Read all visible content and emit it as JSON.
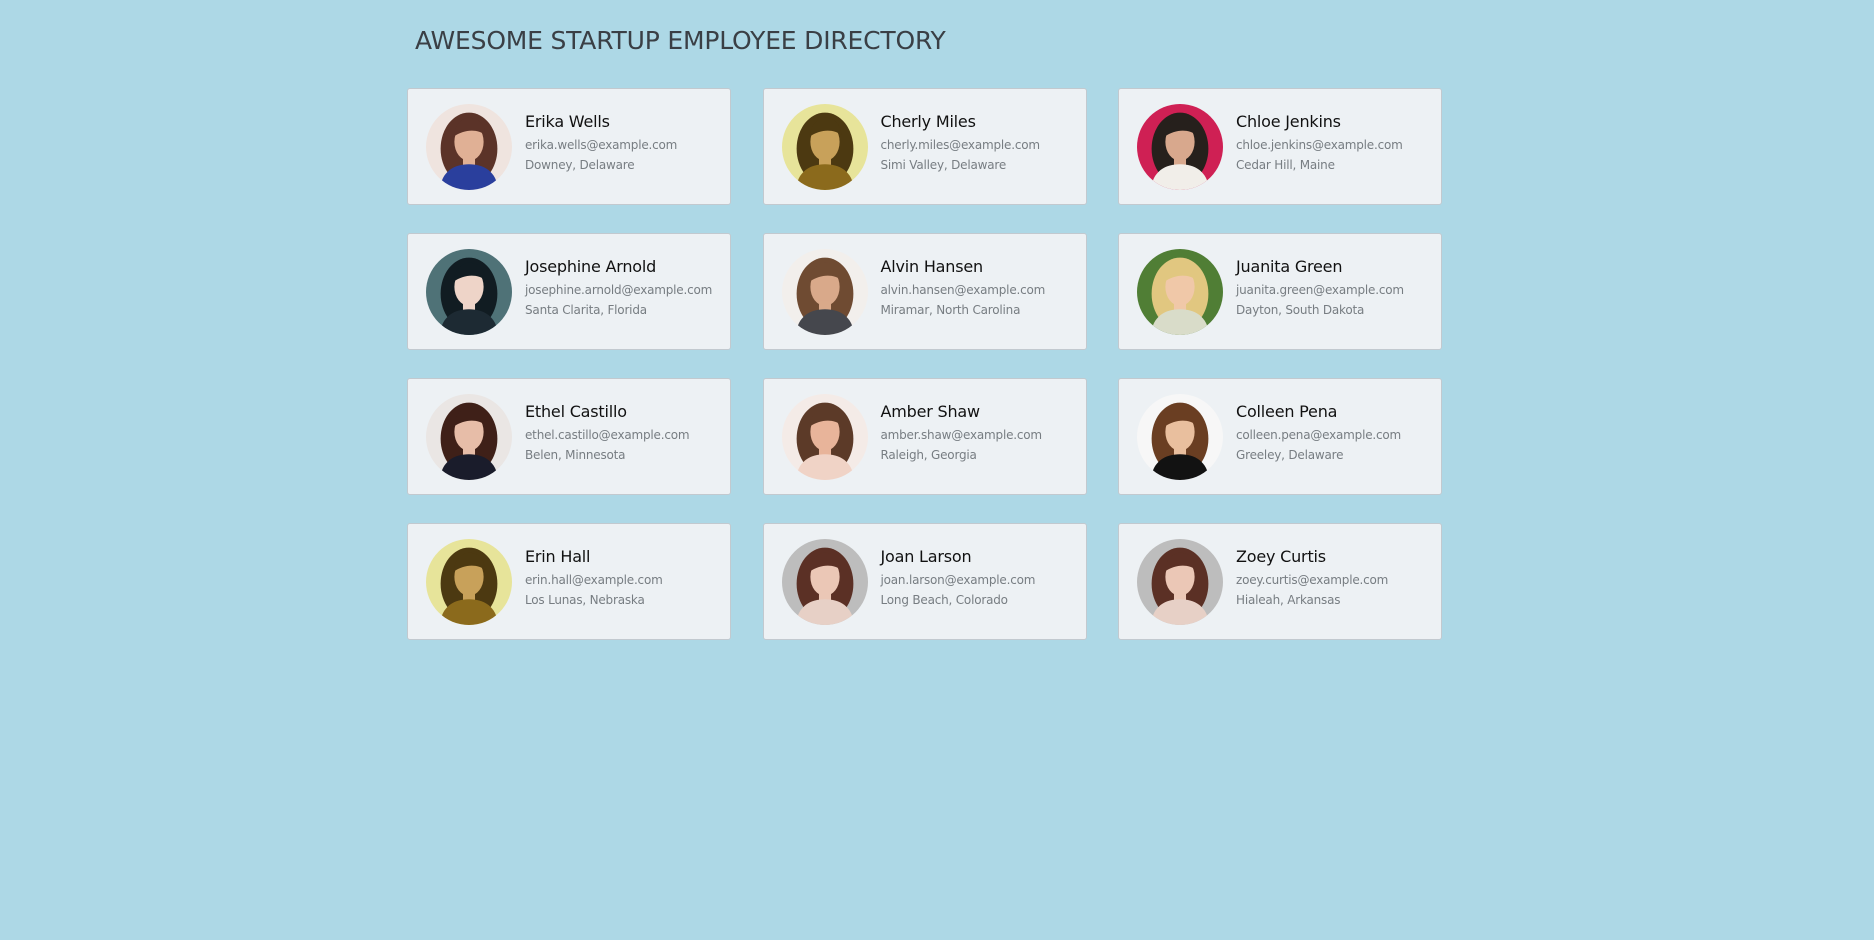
{
  "page": {
    "title": "AWESOME STARTUP EMPLOYEE DIRECTORY",
    "background": "#add8e6",
    "card_background": "#edf1f4",
    "card_border": "#c2c9cf"
  },
  "employees": [
    {
      "name": "Erika Wells",
      "email": "erika.wells@example.com",
      "location": "Downey, Delaware",
      "avatar": {
        "icon": "avatar-woman-brown-hair",
        "bg": "#efe4df",
        "hair": "#5b3328",
        "skin": "#e0b095",
        "shirt": "#2a3f9d"
      }
    },
    {
      "name": "Cherly Miles",
      "email": "cherly.miles@example.com",
      "location": "Simi Valley, Delaware",
      "avatar": {
        "icon": "avatar-woman-yellow-light",
        "bg": "#e7e49a",
        "hair": "#4c3911",
        "skin": "#c8a15a",
        "shirt": "#8b6a1c"
      }
    },
    {
      "name": "Chloe Jenkins",
      "email": "chloe.jenkins@example.com",
      "location": "Cedar Hill, Maine",
      "avatar": {
        "icon": "avatar-woman-curly-hair",
        "bg": "#cf2054",
        "hair": "#26201c",
        "skin": "#d8a88d",
        "shirt": "#f1eee9"
      }
    },
    {
      "name": "Josephine Arnold",
      "email": "josephine.arnold@example.com",
      "location": "Santa Clarita, Florida",
      "avatar": {
        "icon": "avatar-woman-dark-hair",
        "bg": "#4f7277",
        "hair": "#111c22",
        "skin": "#eed4c8",
        "shirt": "#1d2a33"
      }
    },
    {
      "name": "Alvin Hansen",
      "email": "alvin.hansen@example.com",
      "location": "Miramar, North Carolina",
      "avatar": {
        "icon": "avatar-man-smiling",
        "bg": "#f2efec",
        "hair": "#6f4b32",
        "skin": "#d9a98a",
        "shirt": "#45474d"
      }
    },
    {
      "name": "Juanita Green",
      "email": "juanita.green@example.com",
      "location": "Dayton, South Dakota",
      "avatar": {
        "icon": "avatar-woman-blonde",
        "bg": "#507e35",
        "hair": "#e1c780",
        "skin": "#f0c8a8",
        "shirt": "#d9dcc9"
      }
    },
    {
      "name": "Ethel Castillo",
      "email": "ethel.castillo@example.com",
      "location": "Belen, Minnesota",
      "avatar": {
        "icon": "avatar-woman-black-jacket",
        "bg": "#eae6e4",
        "hair": "#3f2018",
        "skin": "#e7bda8",
        "shirt": "#1a1c2b"
      }
    },
    {
      "name": "Amber Shaw",
      "email": "amber.shaw@example.com",
      "location": "Raleigh, Georgia",
      "avatar": {
        "icon": "avatar-woman-hat",
        "bg": "#f4ebe7",
        "hair": "#5c3a28",
        "skin": "#e8b49a",
        "shirt": "#f0d3c6"
      }
    },
    {
      "name": "Colleen Pena",
      "email": "colleen.pena@example.com",
      "location": "Greeley, Delaware",
      "avatar": {
        "icon": "avatar-woman-short-hair",
        "bg": "#f7f7f7",
        "hair": "#6a3e22",
        "skin": "#e9bf9e",
        "shirt": "#121212"
      }
    },
    {
      "name": "Erin Hall",
      "email": "erin.hall@example.com",
      "location": "Los Lunas, Nebraska",
      "avatar": {
        "icon": "avatar-woman-yellow-light",
        "bg": "#e7e49a",
        "hair": "#4c3911",
        "skin": "#c8a15a",
        "shirt": "#8b6a1c"
      }
    },
    {
      "name": "Joan Larson",
      "email": "joan.larson@example.com",
      "location": "Long Beach, Colorado",
      "avatar": {
        "icon": "avatar-woman-gray-background",
        "bg": "#bdbdbd",
        "hair": "#5b3025",
        "skin": "#ebc7b6",
        "shirt": "#e7d0c6"
      }
    },
    {
      "name": "Zoey Curtis",
      "email": "zoey.curtis@example.com",
      "location": "Hialeah, Arkansas",
      "avatar": {
        "icon": "avatar-woman-gray-background",
        "bg": "#bdbdbd",
        "hair": "#5b3025",
        "skin": "#ebc7b6",
        "shirt": "#e7d0c6"
      }
    }
  ]
}
